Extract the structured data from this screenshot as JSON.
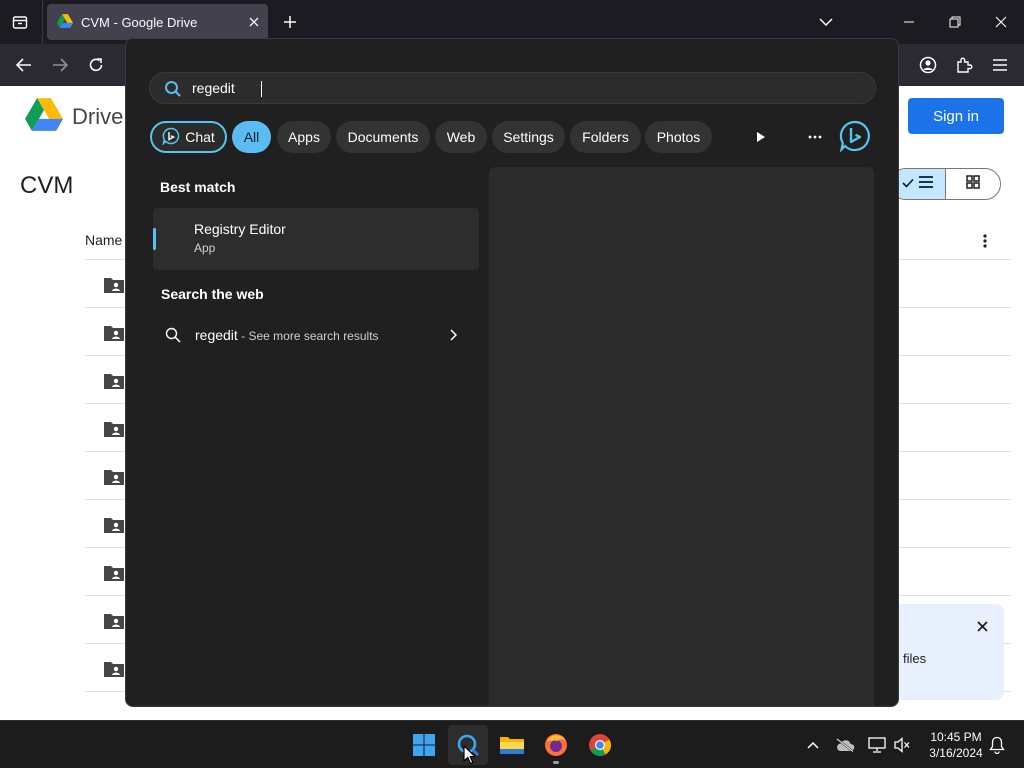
{
  "browser": {
    "tab_title": "CVM - Google Drive"
  },
  "drive": {
    "wordmark": "Drive",
    "sign_in_label": "Sign in",
    "folder_title": "CVM",
    "name_column": "Name",
    "toast_text": "files",
    "folder_row_count": 9
  },
  "search": {
    "query": "regedit",
    "chips": [
      "Chat",
      "All",
      "Apps",
      "Documents",
      "Web",
      "Settings",
      "Folders",
      "Photos"
    ],
    "active_chip": "All",
    "best_match_title": "Best match",
    "best_match": {
      "name": "Registry Editor",
      "type": "App"
    },
    "web_title": "Search the web",
    "web_result": {
      "query": "regedit",
      "hint": " - See more search results"
    }
  },
  "taskbar": {
    "time": "10:45 PM",
    "date": "3/16/2024"
  },
  "colors": {
    "accent": "#58c3f0",
    "flyout_bg": "#202020",
    "drive_blue": "#1a73e8"
  }
}
